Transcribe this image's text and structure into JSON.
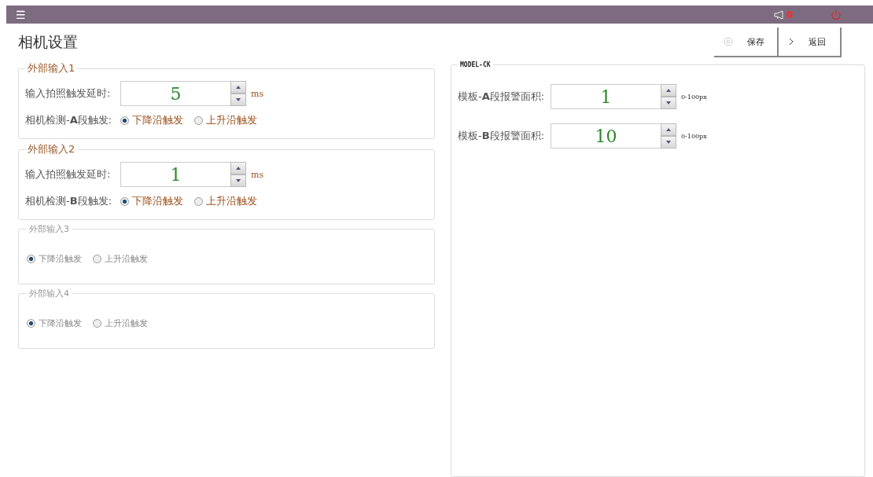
{
  "topbar": {
    "menu_icon": "☰",
    "alarm_count": "0"
  },
  "title": "相机设置",
  "actions": [
    {
      "label": "保存",
      "kind": "save"
    },
    {
      "label": "返回",
      "kind": "back"
    }
  ],
  "groups": [
    {
      "legend": "外部输入1",
      "kind": "full",
      "delay_label": "输入拍照触发延时:",
      "delay_value": "5",
      "unit": "ms",
      "trigger_label": "相机检测-**A**段触发:",
      "options": [
        {
          "label": "下降沿触发",
          "selected": true
        },
        {
          "label": "上升沿触发",
          "selected": false
        }
      ]
    },
    {
      "legend": "外部输入2",
      "kind": "full",
      "delay_label": "输入拍照触发延时:",
      "delay_value": "1",
      "unit": "ms",
      "trigger_label": "相机检测-**B**段触发:",
      "options": [
        {
          "label": "下降沿触发",
          "selected": true
        },
        {
          "label": "上升沿触发",
          "selected": false
        }
      ]
    },
    {
      "legend": "外部输入3",
      "kind": "simple",
      "options": [
        {
          "label": "下降沿触发",
          "selected": true
        },
        {
          "label": "上升沿触发",
          "selected": false
        }
      ]
    },
    {
      "legend": "外部输入4",
      "kind": "simple",
      "options": [
        {
          "label": "下降沿触发",
          "selected": true
        },
        {
          "label": "上升沿触发",
          "selected": false
        }
      ]
    }
  ],
  "model": {
    "legend": "MODEL-CK",
    "fields": [
      {
        "label": "模板-**A**段报警面积:",
        "value": "1",
        "range": "0-100px"
      },
      {
        "label": "模板-**B**段报警面积:",
        "value": "10",
        "range": "0-100px"
      }
    ]
  }
}
